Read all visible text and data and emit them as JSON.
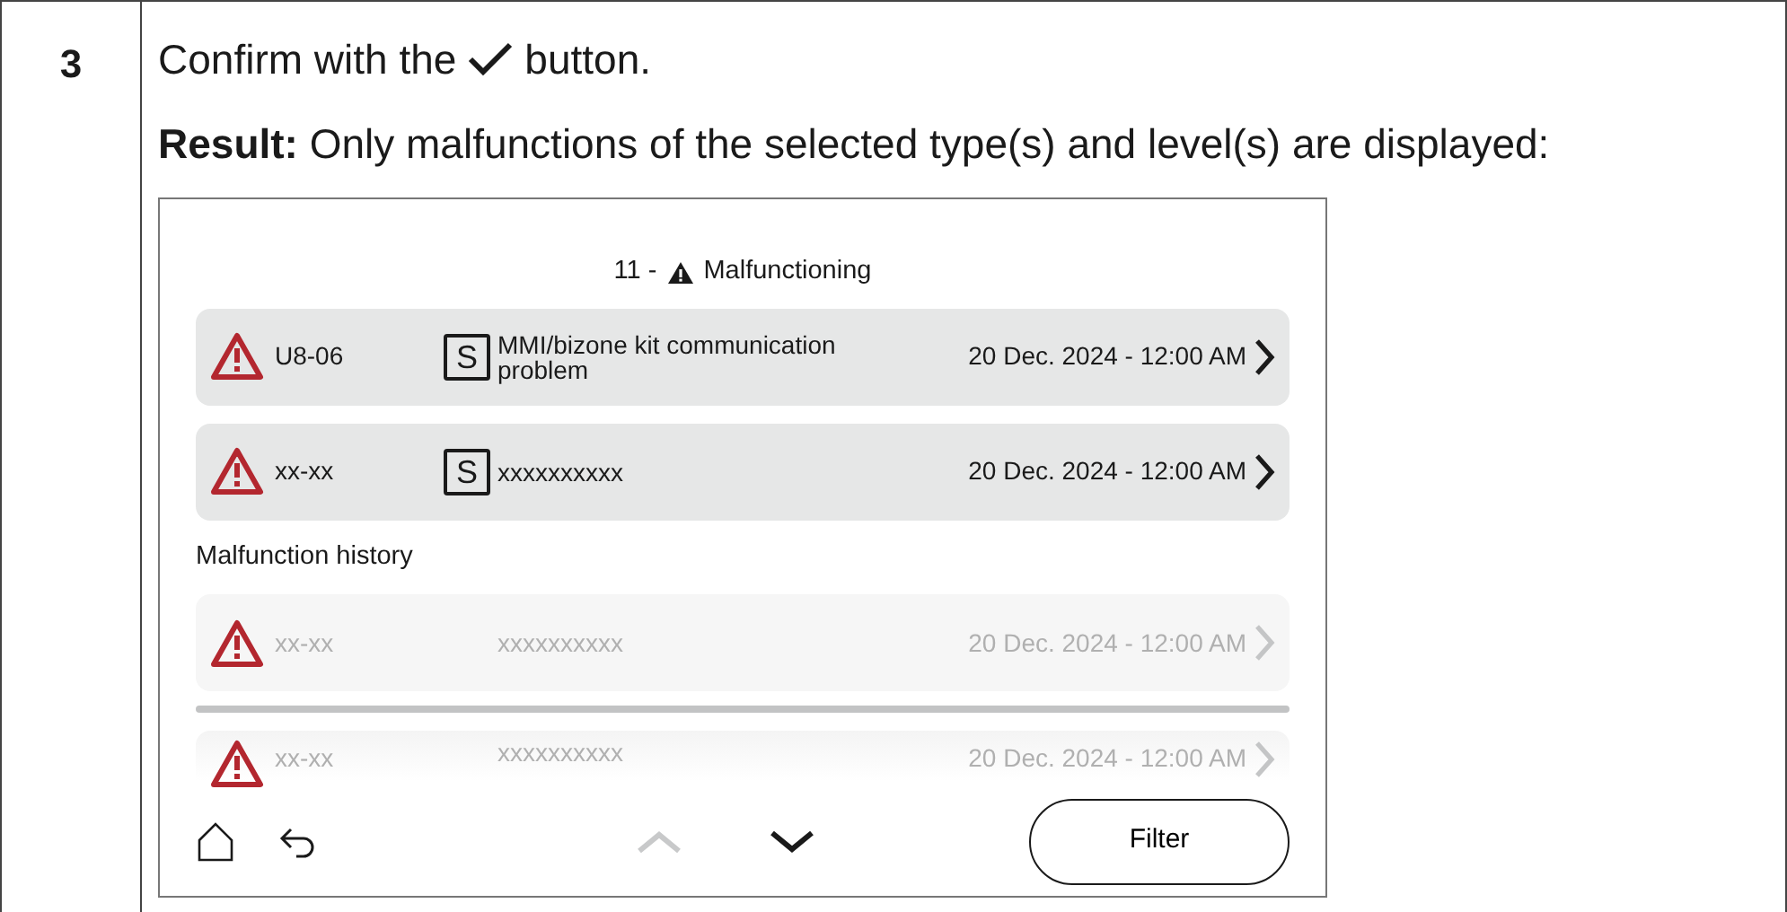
{
  "step": {
    "number": "3",
    "instruction_before": "Confirm with the",
    "instruction_after": "button.",
    "result": "**Result:** Only malfunctions of the selected type(s) and level(s) are displayed:"
  },
  "screen": {
    "title_count": "11 -",
    "title": "Malfunctioning",
    "current": [
      {
        "code": "U8-06",
        "service": "S",
        "description": "MMI/bizone kit communication problem",
        "datetime": "20 Dec. 2024 - 12:00 AM",
        "dimmed": false
      },
      {
        "code": "xx-xx",
        "service": "S",
        "description": "xxxxxxxxxx",
        "datetime": "20 Dec. 2024 - 12:00 AM",
        "dimmed": false
      }
    ],
    "history_label": "Malfunction history",
    "history": [
      {
        "code": "xx-xx",
        "description": "xxxxxxxxxx",
        "datetime": "20 Dec. 2024 - 12:00 AM",
        "dimmed": true
      },
      {
        "code": "xx-xx",
        "description": "xxxxxxxxxx",
        "datetime": "20 Dec. 2024 - 12:00 AM",
        "dimmed": true
      }
    ],
    "nav": {
      "up_disabled": true,
      "down_disabled": false
    },
    "filter_button": "Filter"
  }
}
